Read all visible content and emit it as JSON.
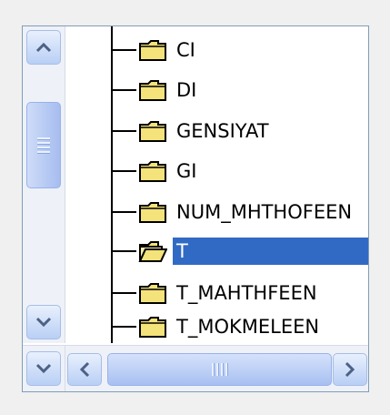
{
  "tree": {
    "items": [
      {
        "label": "CI",
        "icon": "folder-closed-icon",
        "selected": false
      },
      {
        "label": "DI",
        "icon": "folder-closed-icon",
        "selected": false
      },
      {
        "label": "GENSIYAT",
        "icon": "folder-closed-icon",
        "selected": false
      },
      {
        "label": "GI",
        "icon": "folder-closed-icon",
        "selected": false
      },
      {
        "label": "NUM_MHTHOFEEN",
        "icon": "folder-closed-icon",
        "selected": false
      },
      {
        "label": "T",
        "icon": "folder-open-icon",
        "selected": true
      },
      {
        "label": "T_MAHTHFEEN",
        "icon": "folder-closed-icon",
        "selected": false
      },
      {
        "label": "T_MOKMELEEN",
        "icon": "folder-closed-icon",
        "selected": false
      }
    ]
  },
  "scrollbars": {
    "vertical": {
      "up_icon": "chevron-up-icon",
      "down_icon": "chevron-down-icon"
    },
    "horizontal": {
      "left_icon": "chevron-left-icon",
      "right_icon": "chevron-right-icon"
    }
  },
  "colors": {
    "selection": "#316ac5",
    "folder_fill": "#f4e27a",
    "border": "#7f9db9"
  }
}
